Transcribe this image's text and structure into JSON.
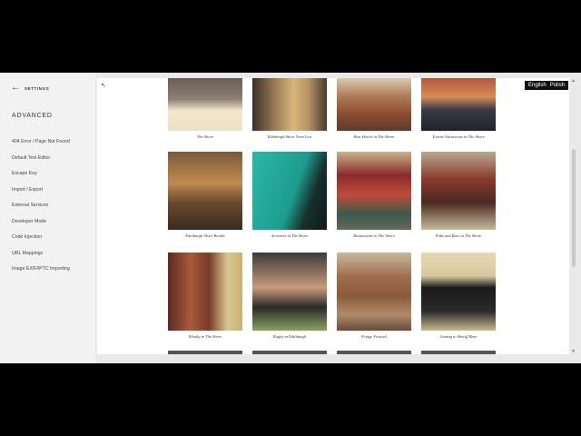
{
  "sidebar": {
    "back_label": "SETTINGS",
    "section_title": "ADVANCED",
    "items": [
      "404 Error / Page Not Found",
      "Default Text Editor",
      "Escape Key",
      "Import / Export",
      "External Services",
      "Developer Mode",
      "Code Injection",
      "URL Mappings",
      "Image EXIF/IPTC Importing"
    ]
  },
  "language_switcher": {
    "english": "English",
    "polish": "Polish"
  },
  "gallery": {
    "row1": [
      "The Shore",
      "Edinburgh Short Term Lets",
      "Best Hotels in The Shore",
      "Tourist Attractions in The Shore"
    ],
    "row2": [
      "Edinburgh Short Breaks",
      "Activities in The Shore",
      "Restaurants in The Shore",
      "Pubs and Bars in The Shore"
    ],
    "row3": [
      "Whisky in The Shore",
      "Rugby in Edinburgh",
      "Fringe Festival",
      "Getting to Sheriff Brae"
    ]
  }
}
